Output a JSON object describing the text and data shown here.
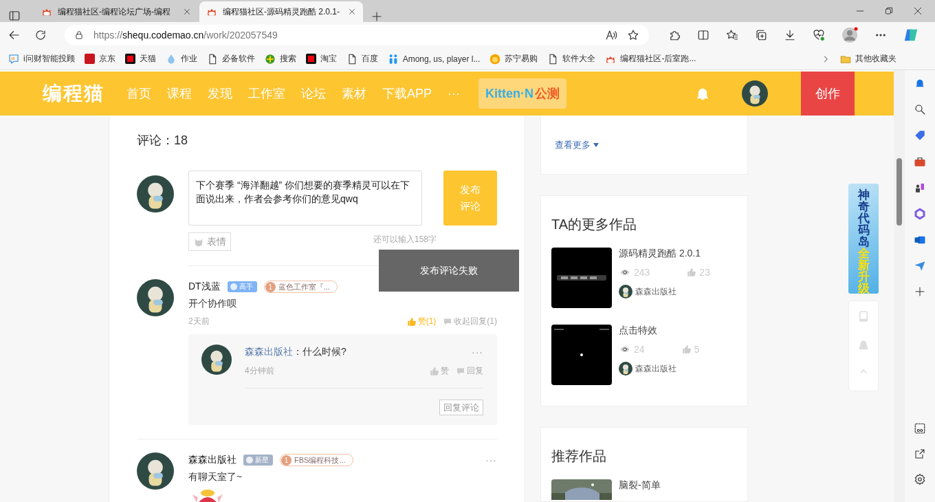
{
  "browser": {
    "tabs": [
      {
        "title": "编程猫社区-编程论坛广场-编程",
        "selected": false
      },
      {
        "title": "编程猫社区-源码精灵跑酷 2.0.1-",
        "selected": true
      }
    ],
    "url": {
      "scheme": "https://",
      "host": "shequ.codemao.cn",
      "path": "/work/202057549"
    },
    "bookmarks": [
      {
        "label": "i问财智能投顾",
        "kind": "chat"
      },
      {
        "label": "京东",
        "kind": "jd"
      },
      {
        "label": "天猫",
        "kind": "red"
      },
      {
        "label": "作业",
        "kind": "drop"
      },
      {
        "label": "必备软件",
        "kind": "page"
      },
      {
        "label": "搜索",
        "kind": "plus"
      },
      {
        "label": "淘宝",
        "kind": "red"
      },
      {
        "label": "百度",
        "kind": "page"
      },
      {
        "label": "Among, us, player l...",
        "kind": "people"
      },
      {
        "label": "苏宁易购",
        "kind": "sun"
      },
      {
        "label": "软件大全",
        "kind": "page"
      },
      {
        "label": "编程猫社区-后室跑...",
        "kind": "cat"
      }
    ],
    "other_bookmarks": "其他收藏夹"
  },
  "site": {
    "logo": "编程猫",
    "nav": [
      "首页",
      "课程",
      "发现",
      "工作室",
      "论坛",
      "素材",
      "下载APP"
    ],
    "more": "···",
    "kitten": {
      "name": "Kitten·N",
      "tag": "公测"
    },
    "create": "创作"
  },
  "comments": {
    "title": "评论：18",
    "draft": "下个赛季 “海洋翻越” 你们想要的赛季精灵可以在下面说出来，作者会参考你们的意见qwq",
    "submit": "发布评论",
    "emoji": "表情",
    "remaining": "还可以输入158字",
    "items": [
      {
        "user": "DT浅蓝",
        "rank": {
          "label": "高手",
          "color": "#7fb3f5"
        },
        "studio_level": "1",
        "studio": "蓝色工作室『...",
        "text": "开个协作呗",
        "time": "2天前",
        "like": "赞(1)",
        "liked": true,
        "reply_toggle": "收起回复(1)",
        "replies": [
          {
            "user": "森森出版社",
            "text": "：什么时候?",
            "time": "4分钟前",
            "like": "赞",
            "liked": false,
            "reply": "回复",
            "more": "···"
          }
        ],
        "reply_button": "回复评论"
      },
      {
        "user": "森森出版社",
        "more": "···",
        "rank": {
          "label": "新星",
          "color": "#a3b2c7"
        },
        "studio_level": "1",
        "studio": "FBS编程科技...",
        "text": "有聊天室了~"
      }
    ],
    "toast": "发布评论失败"
  },
  "sidebar": {
    "more_link": "查看更多",
    "more_works": {
      "title": "TA的更多作品",
      "items": [
        {
          "title": "源码精灵跑酷 2.0.1",
          "views": "243",
          "likes": "23",
          "author": "森森出版社"
        },
        {
          "title": "点击特效",
          "views": "24",
          "likes": "5",
          "author": "森森出版社"
        }
      ]
    },
    "recommended": {
      "title": "推荐作品",
      "items": [
        {
          "title": "脑裂-简单"
        }
      ]
    }
  },
  "ad": {
    "line1": "神奇代码岛",
    "line2": "全新升级"
  }
}
